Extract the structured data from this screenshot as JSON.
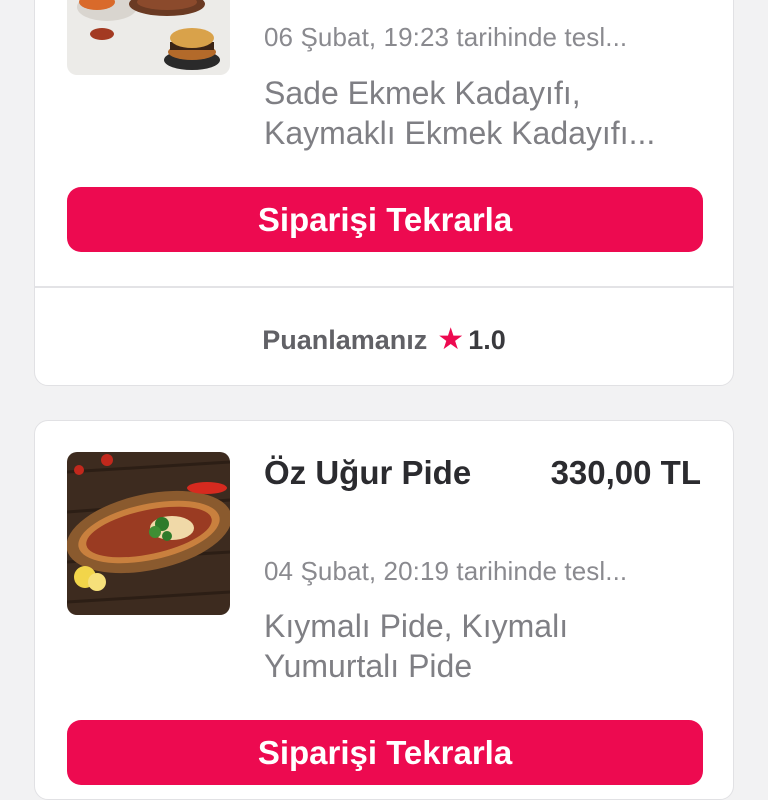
{
  "orders": [
    {
      "date": "06 Şubat, 19:23 tarihinde tesl...",
      "items": "Sade Ekmek Kadayıfı,\nKaymaklı Ekmek Kadayıfı...",
      "reorder_label": "Siparişi Tekrarla",
      "rating_label": "Puanlamanız",
      "rating_value": "1.0"
    },
    {
      "store": "Öz Uğur Pide",
      "price": "330,00 TL",
      "date": "04 Şubat, 20:19 tarihinde tesl...",
      "items": "Kıymalı Pide, Kıymalı\nYumurtalı Pide",
      "reorder_label": "Siparişi Tekrarla"
    }
  ],
  "colors": {
    "accent": "#ed0a50",
    "background": "#f2f2f3"
  }
}
